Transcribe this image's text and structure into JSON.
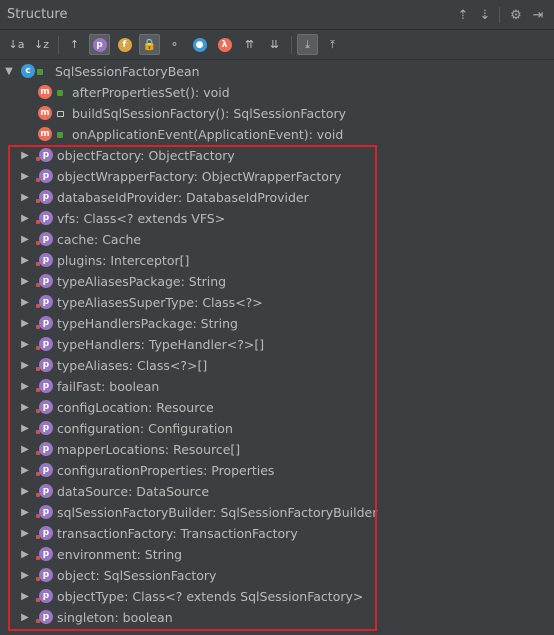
{
  "panel": {
    "title": "Structure"
  },
  "title_tools": [
    {
      "name": "expand-all-icon",
      "glyph": "⇡"
    },
    {
      "name": "collapse-all-icon",
      "glyph": "⇣"
    },
    {
      "name": "gear-icon",
      "glyph": "⚙"
    },
    {
      "name": "hide-icon",
      "glyph": "⇥"
    }
  ],
  "toolbar": [
    {
      "name": "sort-by-visibility-icon",
      "glyph": "↓a",
      "active": false
    },
    {
      "name": "sort-alphabetically-icon",
      "glyph": "↓z",
      "active": false
    },
    {
      "name": "show-inherited-icon",
      "glyph": "↑",
      "active": false
    },
    {
      "name": "show-properties-icon",
      "glyph": "p",
      "active": true
    },
    {
      "name": "show-fields-icon",
      "glyph": "f",
      "active": false
    },
    {
      "name": "show-non-public-icon",
      "glyph": "🔒",
      "active": true
    },
    {
      "name": "show-lambdas-icon",
      "glyph": "⚬",
      "active": false
    },
    {
      "name": "show-anonymous-icon",
      "glyph": "●",
      "active": false
    },
    {
      "name": "lambda-icon",
      "glyph": "λ",
      "active": false
    },
    {
      "name": "expand-icon",
      "glyph": "⇈",
      "active": false
    },
    {
      "name": "collapse-icon",
      "glyph": "⇊",
      "active": false
    },
    {
      "name": "autoscroll-to-source-icon",
      "glyph": "⤓",
      "active": true
    },
    {
      "name": "autoscroll-from-source-icon",
      "glyph": "⤒",
      "active": false
    }
  ],
  "tree": {
    "root": {
      "label": "SqlSessionFactoryBean",
      "icon": "c"
    },
    "methods": [
      {
        "label": "afterPropertiesSet(): void",
        "access": "public"
      },
      {
        "label": "buildSqlSessionFactory(): SqlSessionFactory",
        "access": "protected"
      },
      {
        "label": "onApplicationEvent(ApplicationEvent): void",
        "access": "public"
      }
    ],
    "properties": [
      "objectFactory: ObjectFactory",
      "objectWrapperFactory: ObjectWrapperFactory",
      "databaseIdProvider: DatabaseIdProvider",
      "vfs: Class<? extends VFS>",
      "cache: Cache",
      "plugins: Interceptor[]",
      "typeAliasesPackage: String",
      "typeAliasesSuperType: Class<?>",
      "typeHandlersPackage: String",
      "typeHandlers: TypeHandler<?>[]",
      "typeAliases: Class<?>[]",
      "failFast: boolean",
      "configLocation: Resource",
      "configuration: Configuration",
      "mapperLocations: Resource[]",
      "configurationProperties: Properties",
      "dataSource: DataSource",
      "sqlSessionFactoryBuilder: SqlSessionFactoryBuilder",
      "transactionFactory: TransactionFactory",
      "environment: String",
      "object: SqlSessionFactory",
      "objectType: Class<? extends SqlSessionFactory>",
      "singleton: boolean"
    ]
  },
  "colors": {
    "background": "#3c3f41",
    "property_icon": "#9876c3",
    "method_icon": "#ee6e5a",
    "class_icon": "#3d9ad6",
    "highlight_border": "#d8232a"
  }
}
